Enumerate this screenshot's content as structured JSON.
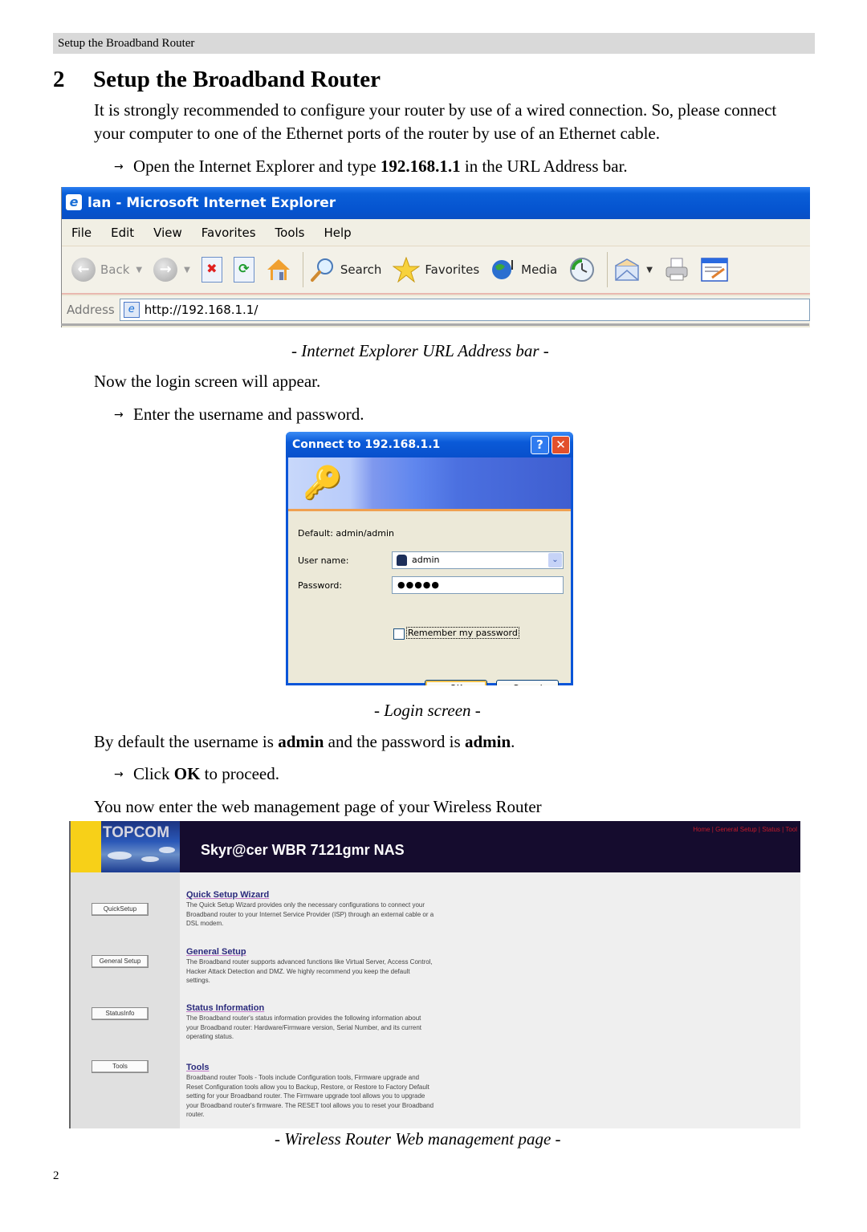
{
  "running_header": "Setup the Broadband Router",
  "section": {
    "number": "2",
    "title": "Setup the Broadband Router"
  },
  "intro": "It is strongly recommended to configure your router by use of a wired connection. So, please connect your computer to one of the Ethernet ports of the router by use of an Ethernet cable.",
  "step1": {
    "arrow": "→",
    "before": "Open the Internet Explorer and type ",
    "bold": "192.168.1.1",
    "after": " in the URL Address bar."
  },
  "ie_window": {
    "title": "lan - Microsoft Internet Explorer",
    "logo_icon": "e",
    "menu": [
      "File",
      "Edit",
      "View",
      "Favorites",
      "Tools",
      "Help"
    ],
    "toolbar": {
      "back": "Back",
      "search": "Search",
      "favorites": "Favorites",
      "media": "Media"
    },
    "address_label": "Address",
    "address_value": "http://192.168.1.1/"
  },
  "caption1": "- Internet Explorer URL Address bar -",
  "para2": "Now the login screen will appear.",
  "step2": {
    "arrow": "→",
    "text": "Enter the username and password."
  },
  "login_dialog": {
    "title": "Connect to 192.168.1.1",
    "help_icon": "?",
    "close_icon": "✕",
    "default_text": "Default: admin/admin",
    "username_label": "User name:",
    "username_value": "admin",
    "password_label": "Password:",
    "password_value": "●●●●●",
    "remember_label": "Remember my password",
    "remember_checked": false,
    "ok_label": "OK",
    "cancel_label": "Cancel"
  },
  "caption2": "- Login screen -",
  "para3": {
    "t1": "By default the username is ",
    "b1": "admin",
    "t2": " and the password is ",
    "b2": "admin",
    "t3": "."
  },
  "step3": {
    "arrow": "→",
    "t1": "Click ",
    "b1": "OK",
    "t2": " to proceed."
  },
  "para4": "You now enter the web management page of your Wireless Router",
  "router_page": {
    "brand": "TOPCOM",
    "product": "Skyr@cer WBR 7121gmr NAS",
    "nav": [
      "Home",
      "General Setup",
      "Status",
      "Tool"
    ],
    "nav_sep": " | ",
    "colors": {
      "header_bg": "#150c2e",
      "yellow": "#f7d018",
      "nav_link": "#c41a2a",
      "section_title": "#2a2a7c"
    },
    "sidebar_buttons": [
      "QuickSetup",
      "General Setup",
      "StatusInfo",
      "Tools"
    ],
    "sections": [
      {
        "title": "Quick Setup Wizard",
        "desc": "The Quick Setup Wizard provides only the necessary configurations to connect your Broadband router to your Internet Service Provider (ISP) through an external cable or a DSL modem."
      },
      {
        "title": "General Setup",
        "desc": "The Broadband router supports advanced functions like Virtual Server, Access Control, Hacker Attack Detection and DMZ. We highly recommend you keep the default settings."
      },
      {
        "title": "Status Information",
        "desc": "The Broadband router's status information provides the following information about your Broadband router: Hardware/Firmware version, Serial Number, and its current operating status."
      },
      {
        "title": "Tools",
        "desc": "Broadband router Tools - Tools include Configuration tools, Firmware upgrade and Reset Configuration tools allow you to Backup, Restore, or Restore to Factory Default setting for your Broadband router. The Firmware upgrade tool allows you to upgrade your Broadband router's firmware. The RESET tool allows you to reset your Broadband router."
      }
    ]
  },
  "caption3": "- Wireless Router Web management page -",
  "page_number": "2"
}
